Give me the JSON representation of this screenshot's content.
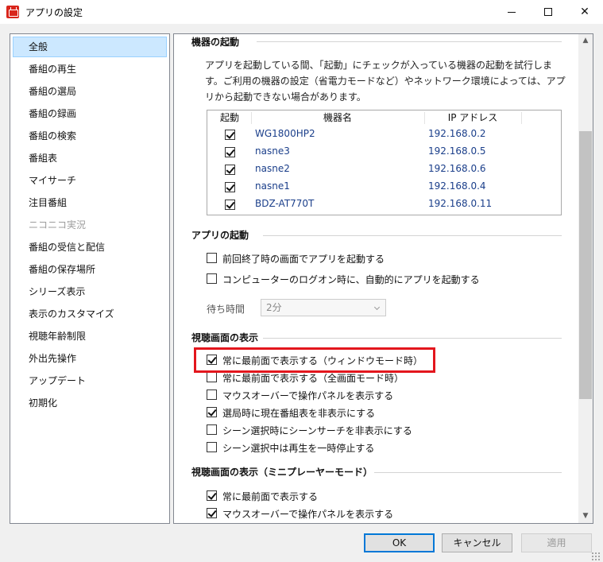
{
  "window": {
    "title": "アプリの設定",
    "controls": {
      "minimize": "minimize",
      "maximize": "maximize",
      "close": "✕"
    }
  },
  "nav": {
    "items": [
      {
        "label": "全般",
        "selected": true
      },
      {
        "label": "番組の再生"
      },
      {
        "label": "番組の選局"
      },
      {
        "label": "番組の録画"
      },
      {
        "label": "番組の検索"
      },
      {
        "label": "番組表"
      },
      {
        "label": "マイサーチ"
      },
      {
        "label": "注目番組"
      },
      {
        "label": "ニコニコ実況",
        "disabled": true
      },
      {
        "label": "番組の受信と配信"
      },
      {
        "label": "番組の保存場所"
      },
      {
        "label": "シリーズ表示"
      },
      {
        "label": "表示のカスタマイズ"
      },
      {
        "label": "視聴年齢制限"
      },
      {
        "label": "外出先操作"
      },
      {
        "label": "アップデート"
      },
      {
        "label": "初期化"
      }
    ]
  },
  "sections": {
    "device_startup": {
      "title": "機器の起動",
      "description": "アプリを起動している間、「起動」にチェックが入っている機器の起動を試行します。ご利用の機器の設定（省電力モードなど）やネットワーク環境によっては、アプリから起動できない場合があります。",
      "columns": {
        "start": "起動",
        "name": "機器名",
        "ip": "IP アドレス"
      },
      "devices": [
        {
          "checked": true,
          "name": "WG1800HP2",
          "ip": "192.168.0.2"
        },
        {
          "checked": true,
          "name": "nasne3",
          "ip": "192.168.0.5"
        },
        {
          "checked": true,
          "name": "nasne2",
          "ip": "192.168.0.6"
        },
        {
          "checked": true,
          "name": "nasne1",
          "ip": "192.168.0.4"
        },
        {
          "checked": true,
          "name": "BDZ-AT770T",
          "ip": "192.168.0.11"
        }
      ]
    },
    "app_startup": {
      "title": "アプリの起動",
      "options": [
        {
          "label": "前回終了時の画面でアプリを起動する",
          "checked": false
        },
        {
          "label": "コンピューターのログオン時に、自動的にアプリを起動する",
          "checked": false
        }
      ],
      "wait_label": "待ち時間",
      "wait_value": "2分"
    },
    "viewing_display": {
      "title": "視聴画面の表示",
      "options": [
        {
          "label": "常に最前面で表示する（ウィンドウモード時）",
          "checked": true
        },
        {
          "label": "常に最前面で表示する（全画面モード時）",
          "checked": false
        },
        {
          "label": "マウスオーバーで操作パネルを表示する",
          "checked": false
        },
        {
          "label": "選局時に現在番組表を非表示にする",
          "checked": true
        },
        {
          "label": "シーン選択時にシーンサーチを非表示にする",
          "checked": false
        },
        {
          "label": "シーン選択中は再生を一時停止する",
          "checked": false
        }
      ]
    },
    "mini_player": {
      "title": "視聴画面の表示（ミニプレーヤーモード）",
      "options": [
        {
          "label": "常に最前面で表示する",
          "checked": true
        },
        {
          "label": "マウスオーバーで操作パネルを表示する",
          "checked": true
        }
      ]
    }
  },
  "buttons": {
    "ok": "OK",
    "cancel": "キャンセル",
    "apply": "適用"
  },
  "colors": {
    "highlight": "#e3161d",
    "selection": "#cce8ff",
    "link_text": "#1a3e8a"
  },
  "icons": {
    "app": "app-icon",
    "scroll_up": "▲",
    "scroll_down": "▼"
  }
}
